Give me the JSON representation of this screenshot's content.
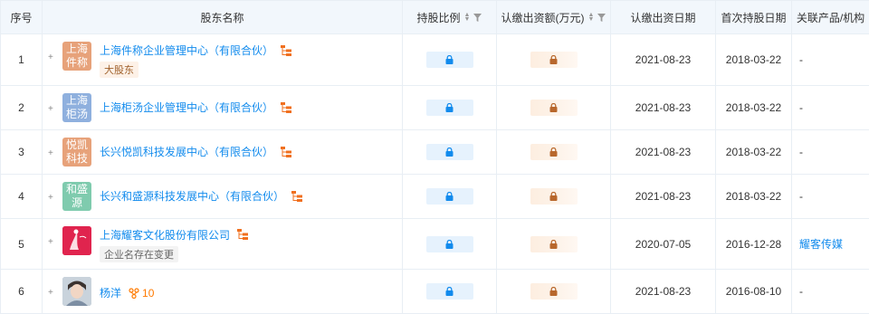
{
  "headers": {
    "index": "序号",
    "name": "股东名称",
    "ratio": "持股比例",
    "capital": "认缴出资额(万元)",
    "date": "认缴出资日期",
    "first": "首次持股日期",
    "related": "关联产品/机构"
  },
  "rows": [
    {
      "index": "1",
      "logo": "上海件称",
      "logo_color": "#e7a27a",
      "name": "上海件称企业管理中心（有限合伙）",
      "tag": "大股东",
      "tag_style": "orange",
      "date": "2021-08-23",
      "first": "2018-03-22",
      "related": "-"
    },
    {
      "index": "2",
      "logo": "上海柜汤",
      "logo_color": "#8fb0de",
      "name": "上海柜汤企业管理中心（有限合伙）",
      "tag": "",
      "date": "2021-08-23",
      "first": "2018-03-22",
      "related": "-"
    },
    {
      "index": "3",
      "logo": "悦凯科技",
      "logo_color": "#e7a27a",
      "name": "长兴悦凯科技发展中心（有限合伙）",
      "tag": "",
      "date": "2021-08-23",
      "first": "2018-03-22",
      "related": "-"
    },
    {
      "index": "4",
      "logo": "和盛源",
      "logo_color": "#7fcbae",
      "name": "长兴和盛源科技发展中心（有限合伙）",
      "tag": "",
      "date": "2021-08-23",
      "first": "2018-03-22",
      "related": "-"
    },
    {
      "index": "5",
      "logo": "",
      "logo_color": "#e0244e",
      "name": "上海耀客文化股份有限公司",
      "tag": "企业名存在变更",
      "tag_style": "grey",
      "date": "2020-07-05",
      "first": "2016-12-28",
      "related": "耀客传媒"
    },
    {
      "index": "6",
      "logo": "",
      "logo_color": "#9aa9b9",
      "name": "杨洋",
      "person_count": "10",
      "tag": "",
      "date": "2021-08-23",
      "first": "2016-08-10",
      "related": "-"
    }
  ]
}
